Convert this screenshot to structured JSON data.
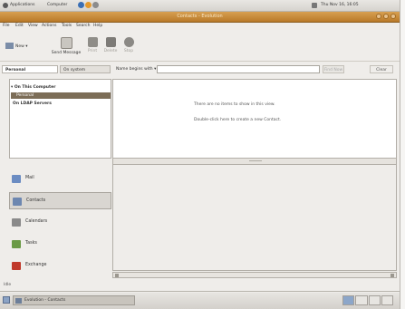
{
  "top_panel": {
    "menus": [
      "Applications",
      "Computer"
    ],
    "clock": "Thu Nov 16, 16:05"
  },
  "window": {
    "title": "Contacts - Evolution"
  },
  "menubar": [
    "File",
    "Edit",
    "View",
    "Actions",
    "Tools",
    "Search",
    "Help"
  ],
  "toolbar": {
    "new_label": "New",
    "send_message_label": "Send Message",
    "print_label": "Print",
    "delete_label": "Delete",
    "stop_label": "Stop"
  },
  "view_tabs": {
    "personal": "Personal",
    "on_system": "On system"
  },
  "search": {
    "label": "Name begins with",
    "value": "",
    "find_now": "Find Now",
    "clear": "Clear"
  },
  "tree": [
    {
      "label": "On This Computer",
      "bold": true,
      "selected": false
    },
    {
      "label": "Personal",
      "bold": false,
      "selected": true
    },
    {
      "label": "On LDAP Servers",
      "bold": true,
      "selected": false
    }
  ],
  "empty_message": {
    "line1": "There are no items to show in this view.",
    "line2": "Double-click here to create a new Contact."
  },
  "shortcuts": [
    {
      "label": "Mail",
      "active": false,
      "color": "#6b8cc2"
    },
    {
      "label": "Contacts",
      "active": true,
      "color": "#6d87b0"
    },
    {
      "label": "Calendars",
      "active": false,
      "color": "#8a8a8a"
    },
    {
      "label": "Tasks",
      "active": false,
      "color": "#6a9a45"
    },
    {
      "label": "Exchange",
      "active": false,
      "color": "#c0392b"
    }
  ],
  "status": "Idle",
  "taskbar": {
    "item": "Evolution - Contacts"
  },
  "colors": {
    "titlebar": "#c8872f",
    "selection": "#7c6d57"
  }
}
